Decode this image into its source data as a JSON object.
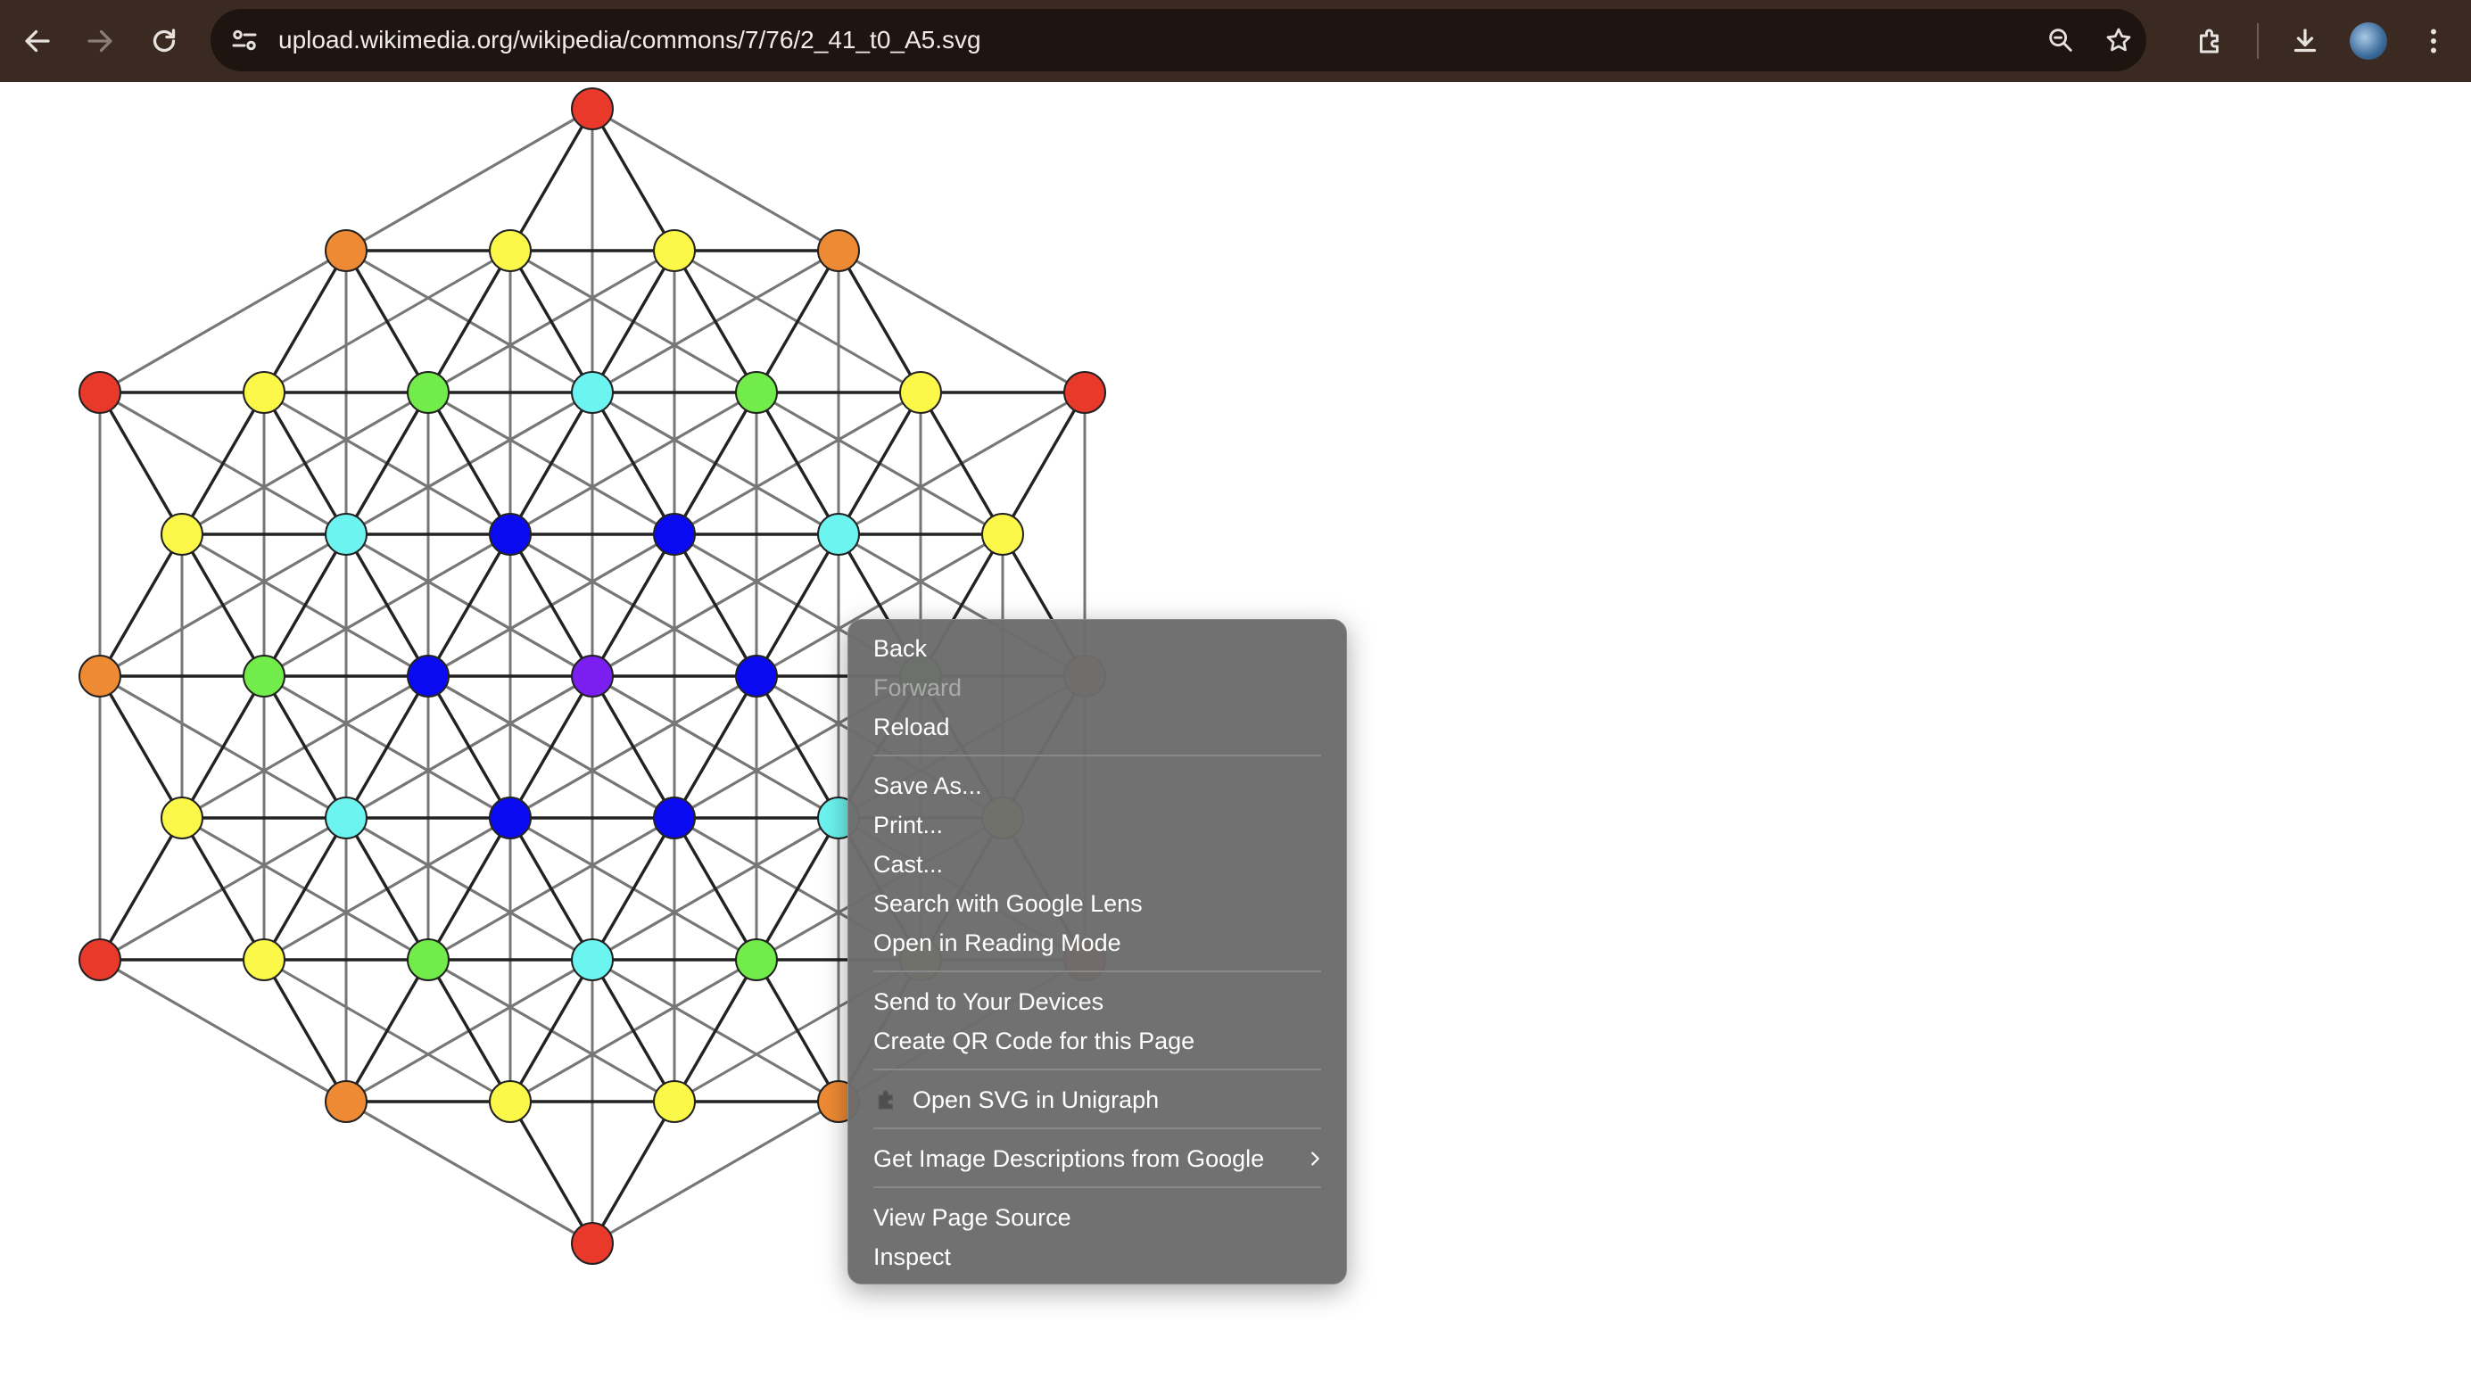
{
  "browser": {
    "url": "upload.wikimedia.org/wikipedia/commons/7/76/2_41_t0_A5.svg",
    "icons": [
      "back-icon",
      "forward-icon",
      "reload-icon",
      "site-info-icon",
      "zoom-icon",
      "star-icon",
      "extensions-icon",
      "download-icon",
      "avatar",
      "more-icon"
    ]
  },
  "context_menu": {
    "back": "Back",
    "forward": "Forward",
    "reload": "Reload",
    "save_as": "Save As...",
    "print": "Print...",
    "cast": "Cast...",
    "search_lens": "Search with Google Lens",
    "reading_mode": "Open in Reading Mode",
    "send_devices": "Send to Your Devices",
    "qr_code": "Create QR Code for this Page",
    "unigraph": "Open SVG in Unigraph",
    "image_descriptions": "Get Image Descriptions from Google",
    "view_source": "View Page Source",
    "inspect": "Inspect"
  },
  "graph": {
    "palette": {
      "red": "#e8392b",
      "orange": "#ef8a34",
      "yellow": "#fbf84a",
      "green": "#72ec4a",
      "cyan": "#6cf4f0",
      "blue": "#0a0af2",
      "purple": "#7a1ff0"
    },
    "edge_colors": {
      "dark": "#222222",
      "light": "#777777"
    }
  }
}
